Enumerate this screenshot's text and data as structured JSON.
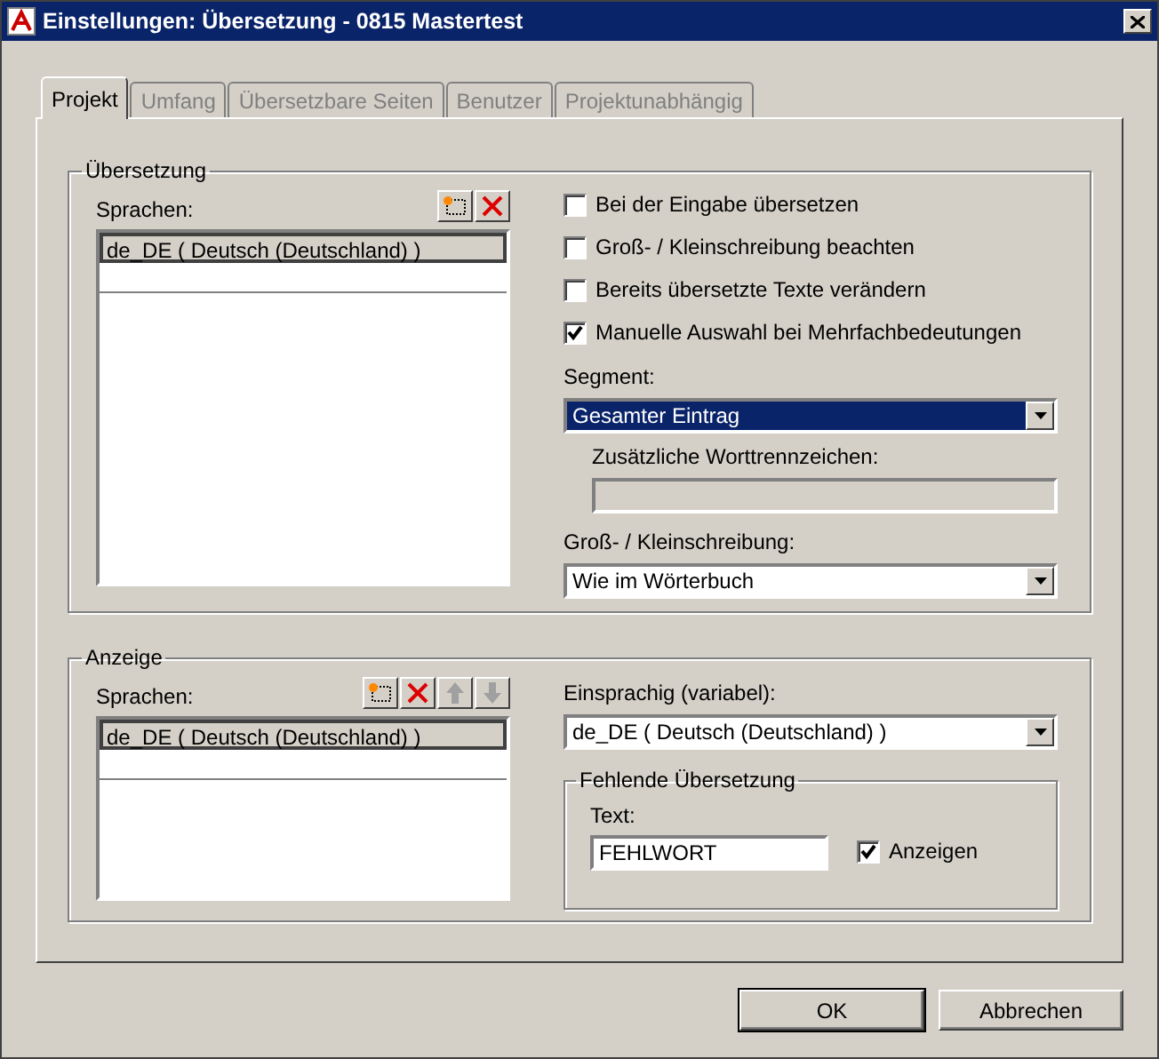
{
  "window": {
    "title": "Einstellungen: Übersetzung - 0815 Mastertest"
  },
  "tabs": [
    {
      "label": "Projekt",
      "selected": true,
      "disabled": false
    },
    {
      "label": "Umfang",
      "selected": false,
      "disabled": true
    },
    {
      "label": "Übersetzbare Seiten",
      "selected": false,
      "disabled": true
    },
    {
      "label": "Benutzer",
      "selected": false,
      "disabled": true
    },
    {
      "label": "Projektunabhängig",
      "selected": false,
      "disabled": true
    }
  ],
  "translation": {
    "legend": "Übersetzung",
    "languages_label": "Sprachen:",
    "tools": [
      {
        "kind": "add",
        "disabled": false
      },
      {
        "kind": "delete",
        "disabled": false
      }
    ],
    "languages": [
      {
        "label": "de_DE ( Deutsch (Deutschland) )",
        "selected": true
      }
    ],
    "options": [
      {
        "label": "Bei der Eingabe übersetzen",
        "checked": false
      },
      {
        "label": "Groß- / Kleinschreibung beachten",
        "checked": false
      },
      {
        "label": "Bereits übersetzte Texte verändern",
        "checked": false
      },
      {
        "label": "Manuelle Auswahl bei Mehrfachbedeutungen",
        "checked": true
      }
    ],
    "segment": {
      "label": "Segment:",
      "value": "Gesamter Eintrag",
      "focused": true
    },
    "separators": {
      "label": "Zusätzliche Worttrennzeichen:",
      "disabled": true
    },
    "case": {
      "label": "Groß- / Kleinschreibung:",
      "value": "Wie im Wörterbuch",
      "focused": false
    }
  },
  "display": {
    "legend": "Anzeige",
    "languages_label": "Sprachen:",
    "tools": [
      {
        "kind": "add",
        "disabled": false
      },
      {
        "kind": "delete",
        "disabled": false
      },
      {
        "kind": "up",
        "disabled": true
      },
      {
        "kind": "down",
        "disabled": true
      }
    ],
    "languages": [
      {
        "label": "de_DE ( Deutsch (Deutschland) )",
        "selected": true
      }
    ],
    "monolingual": {
      "label": "Einsprachig (variabel):",
      "value": "de_DE ( Deutsch (Deutschland) )",
      "focused": false
    },
    "missing": {
      "legend": "Fehlende Übersetzung",
      "text_label": "Text:",
      "text_value": "FEHLWORT",
      "show_label": "Anzeigen",
      "show_checked": true
    }
  },
  "buttons": [
    "OK",
    "Abbrechen"
  ]
}
